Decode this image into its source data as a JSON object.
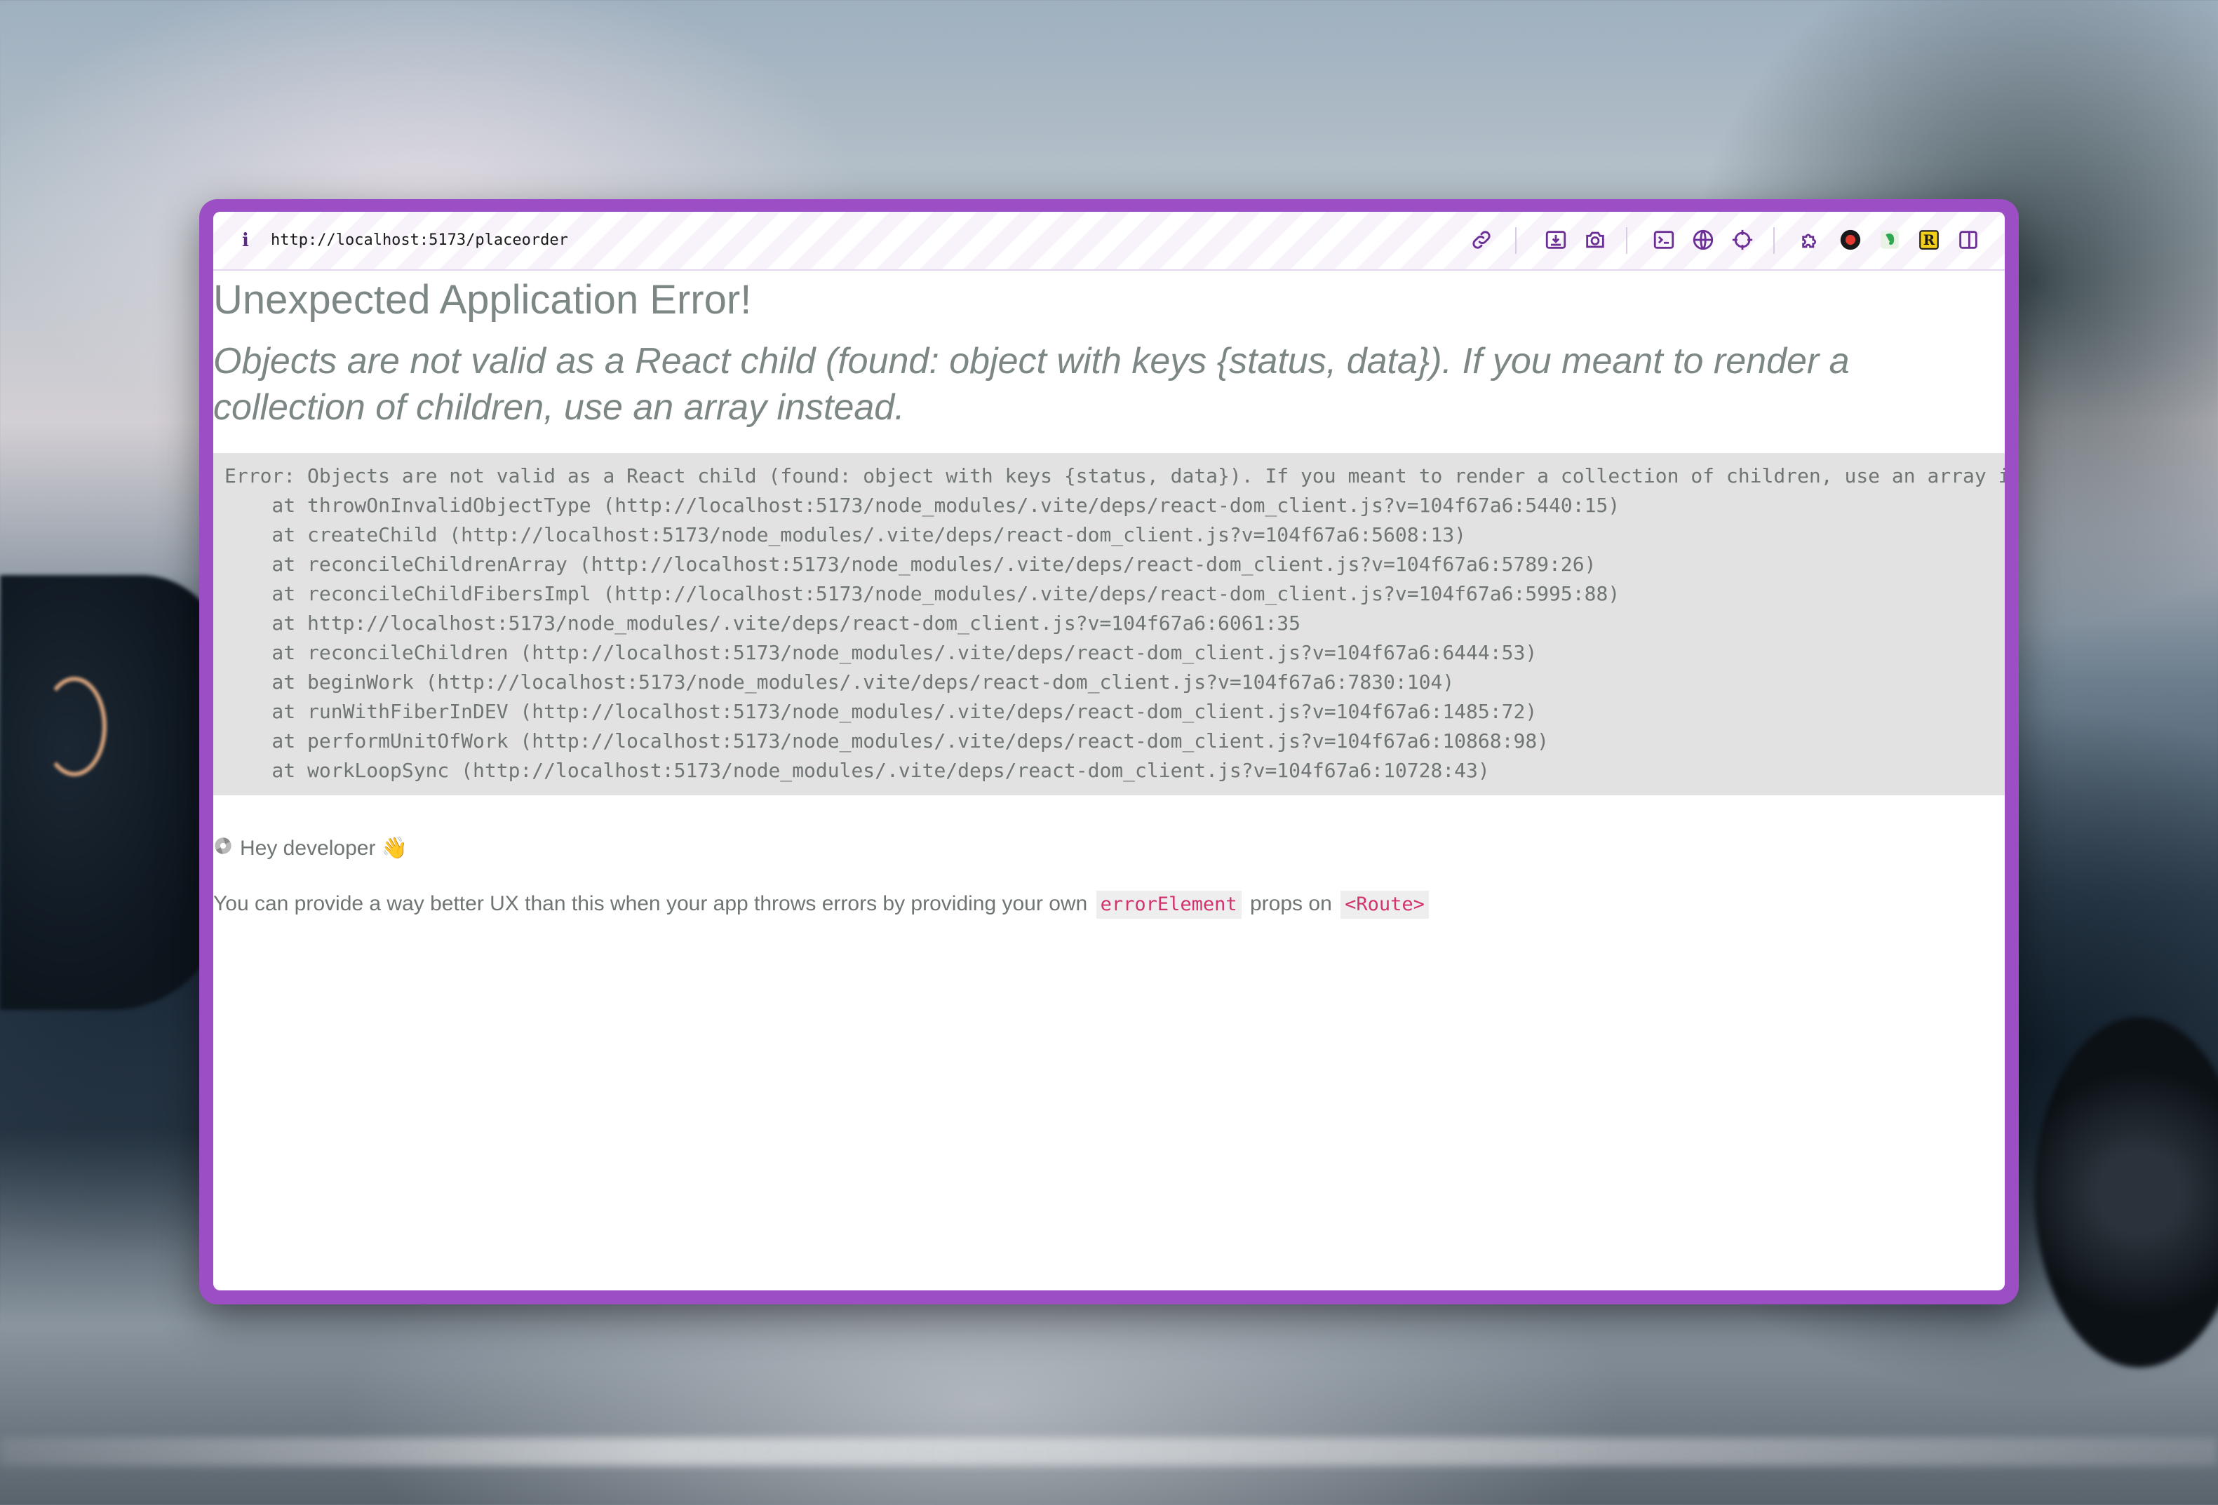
{
  "browser": {
    "url": "http://localhost:5173/placeorder",
    "info_icon_label": "i",
    "toolbar_icons": [
      "link-icon",
      "download-icon",
      "camera-icon",
      "terminal-icon",
      "globe-icon",
      "crosshair-icon",
      "puzzle-icon",
      "record-icon",
      "evernote-icon",
      "r-extension-icon",
      "split-view-icon"
    ],
    "r_extension_label": "R"
  },
  "error_page": {
    "title": "Unexpected Application Error!",
    "message": "Objects are not valid as a React child (found: object with keys {status, data}). If you meant to render a collection of children, use an array instead.",
    "stack": [
      "Error: Objects are not valid as a React child (found: object with keys {status, data}). If you meant to render a collection of children, use an array instead.",
      "    at throwOnInvalidObjectType (http://localhost:5173/node_modules/.vite/deps/react-dom_client.js?v=104f67a6:5440:15)",
      "    at createChild (http://localhost:5173/node_modules/.vite/deps/react-dom_client.js?v=104f67a6:5608:13)",
      "    at reconcileChildrenArray (http://localhost:5173/node_modules/.vite/deps/react-dom_client.js?v=104f67a6:5789:26)",
      "    at reconcileChildFibersImpl (http://localhost:5173/node_modules/.vite/deps/react-dom_client.js?v=104f67a6:5995:88)",
      "    at http://localhost:5173/node_modules/.vite/deps/react-dom_client.js?v=104f67a6:6061:35",
      "    at reconcileChildren (http://localhost:5173/node_modules/.vite/deps/react-dom_client.js?v=104f67a6:6444:53)",
      "    at beginWork (http://localhost:5173/node_modules/.vite/deps/react-dom_client.js?v=104f67a6:7830:104)",
      "    at runWithFiberInDEV (http://localhost:5173/node_modules/.vite/deps/react-dom_client.js?v=104f67a6:1485:72)",
      "    at performUnitOfWork (http://localhost:5173/node_modules/.vite/deps/react-dom_client.js?v=104f67a6:10868:98)",
      "    at workLoopSync (http://localhost:5173/node_modules/.vite/deps/react-dom_client.js?v=104f67a6:10728:43)"
    ],
    "hey_text": "Hey developer 👋",
    "tip_prefix": "You can provide a way better UX than this when your app throws errors by providing your own",
    "tip_code1": "errorElement",
    "tip_middle": "props on",
    "tip_code2": "<Route>"
  },
  "colors": {
    "window_frame": "#9c4fc4",
    "heading_text": "#7c8786",
    "code_text": "#d1336e",
    "stack_bg": "#e2e2e2"
  }
}
